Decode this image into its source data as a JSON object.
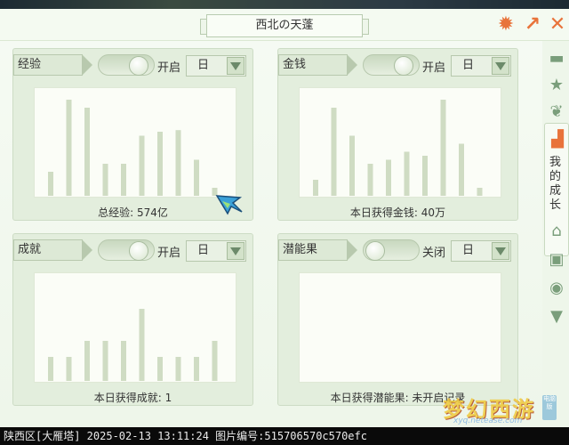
{
  "title": "西北の天蓬",
  "panels": [
    {
      "label": "经验",
      "toggle_label": "开启",
      "toggle_on": true,
      "period": "日",
      "caption": "总经验: 574亿",
      "values": [
        3,
        12,
        11,
        4,
        4,
        7.5,
        8,
        8.2,
        4.5,
        1
      ]
    },
    {
      "label": "金钱",
      "toggle_label": "开启",
      "toggle_on": true,
      "period": "日",
      "caption": "本日获得金钱: 40万",
      "values": [
        2,
        11,
        7.5,
        4,
        4.5,
        5.5,
        5,
        12,
        6.5,
        1
      ]
    },
    {
      "label": "成就",
      "toggle_label": "开启",
      "toggle_on": true,
      "period": "日",
      "caption": "本日获得成就: 1",
      "values": [
        3,
        3,
        5,
        5,
        5,
        9,
        3,
        3,
        3,
        5
      ]
    },
    {
      "label": "潜能果",
      "toggle_label": "关闭",
      "toggle_on": false,
      "period": "日",
      "caption": "本日获得潜能果: 未开启记录",
      "values": []
    }
  ],
  "sidebar": {
    "icons": [
      "chat-icon",
      "star-icon",
      "paw-icon",
      "signal-bars-icon",
      "home-icon",
      "box-icon",
      "palette-icon",
      "shirt-icon"
    ],
    "active_tab_label": "我的成长"
  },
  "statusbar": "陕西区[大雁塔] 2025-02-13 13:11:24 图片编号:515706570c570efc",
  "watermark": {
    "main": "梦幻西游",
    "url": "xyq.netease.com",
    "badge": "电脑版"
  },
  "colors": {
    "bar": "#cfdcc3",
    "accent": "#e8733b",
    "sidebar_icon": "#7a9e7b"
  }
}
